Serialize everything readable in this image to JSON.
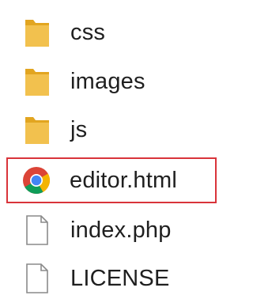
{
  "file_list": {
    "items": [
      {
        "name": "css",
        "icon": "folder-icon",
        "selected": false
      },
      {
        "name": "images",
        "icon": "folder-icon",
        "selected": false
      },
      {
        "name": "js",
        "icon": "folder-icon",
        "selected": false
      },
      {
        "name": "editor.html",
        "icon": "chrome-icon",
        "selected": true
      },
      {
        "name": "index.php",
        "icon": "file-icon",
        "selected": false
      },
      {
        "name": "LICENSE",
        "icon": "file-icon",
        "selected": false
      }
    ]
  },
  "colors": {
    "folder": "#f2c14e",
    "folder_dark": "#e2a520",
    "selection_border": "#d9343a",
    "chrome_red": "#db4437",
    "chrome_green": "#0f9d58",
    "chrome_yellow": "#f4b400",
    "chrome_blue": "#4285f4"
  }
}
